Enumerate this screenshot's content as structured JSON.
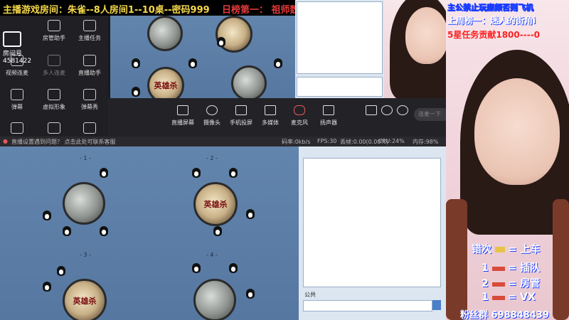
{
  "banner": {
    "main": "主播游戏房间：朱雀--8人房间1--10桌--密码999",
    "rank": "日榜第一：  祖师魏无羡"
  },
  "room": {
    "label": "房间号",
    "id": "4581422"
  },
  "tools": [
    "房管助手",
    "主播任务",
    "视频连麦",
    "多人连麦",
    "直播助手",
    "弹幕",
    "虚拟形象",
    "弹幕秀"
  ],
  "toolbar": {
    "buttons": [
      "直播屏幕",
      "摄像头",
      "手机投屏",
      "多媒体",
      "麦克风",
      "扬声器"
    ],
    "search_placeholder": "连麦一下"
  },
  "status": {
    "warning": "直播设置遇到问题？ 点击此处可联系客服",
    "codec": "码率:0kb/s",
    "fps": "FPS:30",
    "drop": "丢帧:0.00(0.00%)",
    "cpu": "CPU:24%",
    "mem": "内存:98%"
  },
  "game": {
    "tables": [
      "- 1 -",
      "- 2 -",
      "- 3 -",
      "- 4 -"
    ],
    "logo_text": "英雄杀",
    "chat_label": "公共"
  },
  "overlay": {
    "line1": "主公禁止玩廉颇否则飞机",
    "line2": "上周榜一：迷人的街角i",
    "line3": "5星任务贡献1800----0",
    "promo_title": "错次",
    "promo_title_tail": "= 上车",
    "promo_items": [
      {
        "num": "1",
        "text": "= 插队"
      },
      {
        "num": "2",
        "text": "= 房管"
      },
      {
        "num": "1",
        "text": "= VX"
      }
    ],
    "fan_group": "粉丝群 698848439"
  },
  "colors": {
    "banner_text": "#f5d84a",
    "rank_text": "#e63a3a",
    "overlay_blue": "#1a3cff",
    "promo_white": "#ffffff"
  }
}
